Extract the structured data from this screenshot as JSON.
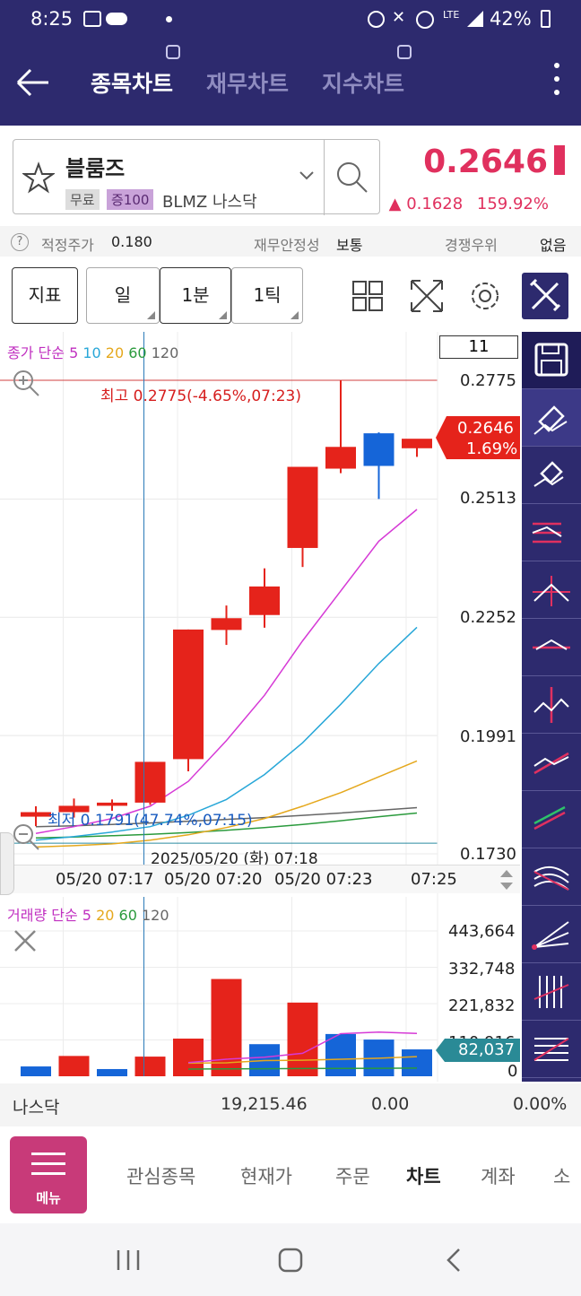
{
  "status_bar": {
    "time": "8:25",
    "battery": "42%",
    "network": "LTE"
  },
  "header": {
    "tabs": [
      {
        "label": "종목차트",
        "active": true
      },
      {
        "label": "재무차트",
        "active": false
      },
      {
        "label": "지수차트",
        "active": false
      }
    ]
  },
  "stock": {
    "name": "블룸즈",
    "tag_fee": "무료",
    "tag_margin": "증100",
    "code": "BLMZ",
    "market": "나스닥",
    "price": "0.2646",
    "change": "▲ 0.1628",
    "change_pct": "159.92%"
  },
  "info": {
    "fair_label": "적정주가",
    "fair_value": "0.180",
    "stability_label": "재무안정성",
    "stability_value": "보통",
    "competition_label": "경쟁우위",
    "competition_value": "없음"
  },
  "toolbar": {
    "indicator_label": "지표",
    "period_day": "일",
    "period_min": "1분",
    "period_tick": "1틱"
  },
  "chart": {
    "count_box": "11",
    "price_legend_prefix": "종가 단순",
    "price_legend_ma": [
      "5",
      "10",
      "20",
      "60",
      "120"
    ],
    "high_label": "최고 0.2775(-4.65%,07:23)",
    "low_label": "최저 0.1791(47.74%,07:15)",
    "current_price_tag": "0.2646",
    "current_pct_tag": "1.69%",
    "crosshair_date": "2025/05/20 (화) 07:18",
    "y_ticks": [
      "0.2775",
      "0.2513",
      "0.2252",
      "0.1991",
      "0.1730"
    ],
    "x_ticks": [
      "05/20 07:17",
      "05/20 07:20",
      "05/20 07:23",
      "07:25"
    ],
    "volume_legend_prefix": "거래량 단순",
    "volume_legend_ma": [
      "5",
      "20",
      "60",
      "120"
    ],
    "volume_ticks": [
      "443,664",
      "332,748",
      "221,832",
      "110,916",
      "0"
    ],
    "volume_current_tag": "82,037",
    "colors": {
      "up": "#e5231b",
      "down": "#1565d8",
      "ma5": "#d63ad6",
      "ma10": "#28a7d8",
      "ma20": "#e5a81d",
      "ma60": "#2a9a3c",
      "ma120": "#666666"
    }
  },
  "chart_data": {
    "type": "candlestick",
    "x": [
      "07:15",
      "07:16",
      "07:17",
      "07:18",
      "07:19",
      "07:20",
      "07:21",
      "07:22",
      "07:23",
      "07:24",
      "07:25"
    ],
    "candles": [
      {
        "o": 0.1812,
        "h": 0.1835,
        "l": 0.1791,
        "c": 0.1822
      },
      {
        "o": 0.1822,
        "h": 0.1852,
        "l": 0.181,
        "c": 0.1836
      },
      {
        "o": 0.1836,
        "h": 0.185,
        "l": 0.1825,
        "c": 0.1843
      },
      {
        "o": 0.1843,
        "h": 0.1933,
        "l": 0.1838,
        "c": 0.1933
      },
      {
        "o": 0.1939,
        "h": 0.2225,
        "l": 0.1912,
        "c": 0.2225
      },
      {
        "o": 0.2224,
        "h": 0.2278,
        "l": 0.2191,
        "c": 0.225
      },
      {
        "o": 0.2257,
        "h": 0.236,
        "l": 0.2229,
        "c": 0.232
      },
      {
        "o": 0.2405,
        "h": 0.2584,
        "l": 0.2363,
        "c": 0.2584
      },
      {
        "o": 0.258,
        "h": 0.2775,
        "l": 0.257,
        "c": 0.2628
      },
      {
        "o": 0.2658,
        "h": 0.266,
        "l": 0.2513,
        "c": 0.2586
      },
      {
        "o": 0.2625,
        "h": 0.2629,
        "l": 0.2606,
        "c": 0.2646
      }
    ],
    "ma5": [
      0.1775,
      0.179,
      0.1808,
      0.1835,
      0.189,
      0.198,
      0.208,
      0.22,
      0.231,
      0.242,
      0.249
    ],
    "ma10": [
      0.176,
      0.1768,
      0.1778,
      0.179,
      0.1815,
      0.185,
      0.1905,
      0.1975,
      0.206,
      0.215,
      0.223
    ],
    "ma20": [
      0.1745,
      0.1748,
      0.1752,
      0.176,
      0.1772,
      0.1788,
      0.1808,
      0.1835,
      0.1865,
      0.19,
      0.1935
    ],
    "ma60": [
      0.1765,
      0.1767,
      0.177,
      0.1773,
      0.1777,
      0.1782,
      0.1788,
      0.1795,
      0.1803,
      0.1812,
      0.182
    ],
    "ma120": [
      0.179,
      0.1792,
      0.1795,
      0.1798,
      0.1802,
      0.1806,
      0.181,
      0.1815,
      0.182,
      0.1826,
      0.1832
    ],
    "ylim": [
      0.173,
      0.2775
    ],
    "volume": [
      {
        "v": 30000,
        "up": false
      },
      {
        "v": 62000,
        "up": true
      },
      {
        "v": 22000,
        "up": false
      },
      {
        "v": 60000,
        "up": true
      },
      {
        "v": 115000,
        "up": true
      },
      {
        "v": 297000,
        "up": true
      },
      {
        "v": 98000,
        "up": false
      },
      {
        "v": 225000,
        "up": true
      },
      {
        "v": 129000,
        "up": false
      },
      {
        "v": 112000,
        "up": false
      },
      {
        "v": 82037,
        "up": false
      }
    ],
    "vol_ma5": [
      null,
      null,
      null,
      null,
      42000,
      52000,
      58000,
      70000,
      130000,
      135000,
      131000
    ],
    "vol_ma20": [
      null,
      null,
      null,
      null,
      40000,
      41000,
      48000,
      49000,
      52000,
      55000,
      60000
    ],
    "vol_ma60": [
      null,
      null,
      null,
      null,
      22000,
      22500,
      23000,
      23500,
      24000,
      24500,
      25000
    ],
    "vlim": [
      0,
      443664
    ]
  },
  "index_bar": {
    "name": "나스닥",
    "value": "19,215.46",
    "change": "0.00",
    "pct": "0.00%"
  },
  "bottom_nav": {
    "menu_label": "메뉴",
    "items": [
      {
        "label": "관심종목",
        "active": false
      },
      {
        "label": "현재가",
        "active": false
      },
      {
        "label": "주문",
        "active": false
      },
      {
        "label": "차트",
        "active": true
      },
      {
        "label": "계좌",
        "active": false
      },
      {
        "label": "소",
        "active": false
      }
    ]
  }
}
